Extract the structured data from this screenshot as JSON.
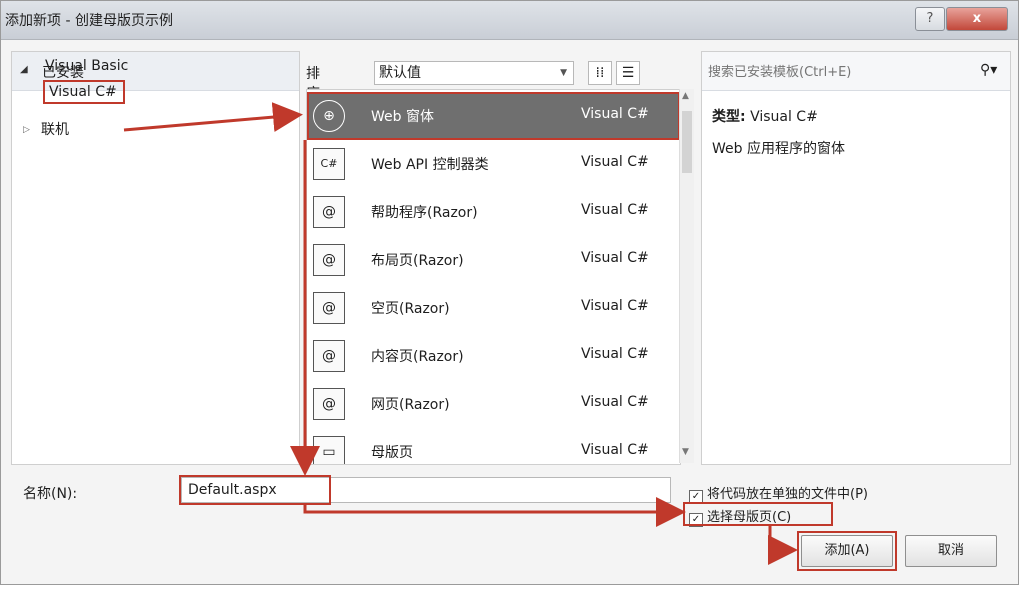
{
  "window": {
    "title": "添加新项 - 创建母版页示例",
    "help": "?",
    "close": "x"
  },
  "left": {
    "installed": "已安装",
    "tree": [
      "Visual Basic",
      "Visual C#"
    ],
    "online": "联机"
  },
  "sort": {
    "label": "排序依据:",
    "value": "默认值"
  },
  "templates": [
    {
      "name": "Web 窗体",
      "lang": "Visual C#",
      "icon": "globe-icon",
      "glyph": "⊕"
    },
    {
      "name": "Web API 控制器类",
      "lang": "Visual C#",
      "icon": "web-api-icon",
      "glyph": "C#"
    },
    {
      "name": "帮助程序(Razor)",
      "lang": "Visual C#",
      "icon": "razor-icon",
      "glyph": "@"
    },
    {
      "name": "布局页(Razor)",
      "lang": "Visual C#",
      "icon": "razor-icon",
      "glyph": "@"
    },
    {
      "name": "空页(Razor)",
      "lang": "Visual C#",
      "icon": "razor-icon",
      "glyph": "@"
    },
    {
      "name": "内容页(Razor)",
      "lang": "Visual C#",
      "icon": "razor-icon",
      "glyph": "@"
    },
    {
      "name": "网页(Razor)",
      "lang": "Visual C#",
      "icon": "razor-icon",
      "glyph": "@"
    },
    {
      "name": "母版页",
      "lang": "Visual C#",
      "icon": "master-page-icon",
      "glyph": "▭"
    }
  ],
  "search": {
    "placeholder": "搜索已安装模板(Ctrl+E)"
  },
  "details": {
    "type_label": "类型:",
    "type_value": "Visual C#",
    "description": "Web 应用程序的窗体"
  },
  "bottom": {
    "name_label": "名称(N):",
    "name_value": "Default.aspx",
    "cb1": "将代码放在单独的文件中(P)",
    "cb2": "选择母版页(C)",
    "add": "添加(A)",
    "cancel": "取消"
  },
  "colors": {
    "highlight": "#c0392b",
    "selected": "#6f6f6f"
  }
}
